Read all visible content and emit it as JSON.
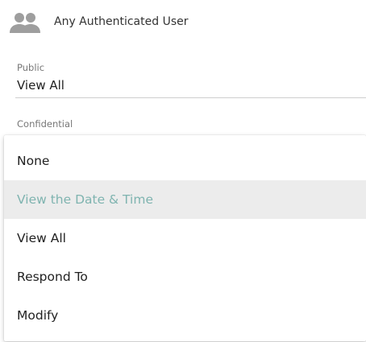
{
  "user": {
    "icon": "group-icon",
    "name": "Any Authenticated User"
  },
  "public": {
    "label": "Public",
    "value": "View All"
  },
  "confidential": {
    "label": "Confidential",
    "options": [
      {
        "label": "None"
      },
      {
        "label": "View the Date & Time",
        "highlighted": true
      },
      {
        "label": "View All"
      },
      {
        "label": "Respond To"
      },
      {
        "label": "Modify"
      }
    ]
  },
  "colors": {
    "highlight_text": "#7fb4b0",
    "highlight_bg": "#ececec",
    "icon": "#9e9e9e"
  }
}
